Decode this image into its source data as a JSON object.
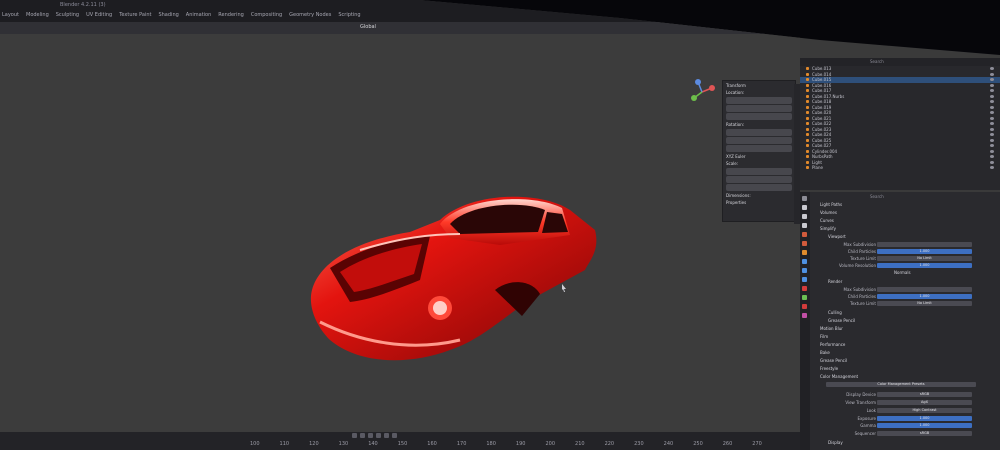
{
  "window": {
    "title": "Blender 4.2.11 (3)"
  },
  "menus": [
    "Layout",
    "Modeling",
    "Sculpting",
    "UV Editing",
    "Texture Paint",
    "Shading",
    "Animation",
    "Rendering",
    "Compositing",
    "Geometry Nodes",
    "Scripting"
  ],
  "viewport": {
    "mode": "Global"
  },
  "npanel": {
    "transform_header": "Transform",
    "location": "Location:",
    "rotation": "Rotation:",
    "mode": "XYZ Euler",
    "scale": "Scale:",
    "dimensions": "Dimensions:",
    "properties": "Properties"
  },
  "outliner": {
    "search_placeholder": "Search",
    "rows": [
      {
        "name": "Cube.013"
      },
      {
        "name": "Cube.014"
      },
      {
        "name": "Cube.015",
        "selected": true
      },
      {
        "name": "Cube.016"
      },
      {
        "name": "Cube.017"
      },
      {
        "name": "Cube.017.Nurbs"
      },
      {
        "name": "Cube.018"
      },
      {
        "name": "Cube.019"
      },
      {
        "name": "Cube.020"
      },
      {
        "name": "Cube.021"
      },
      {
        "name": "Cube.022"
      },
      {
        "name": "Cube.023"
      },
      {
        "name": "Cube.024"
      },
      {
        "name": "Cube.025"
      },
      {
        "name": "Cube.027"
      },
      {
        "name": "Cylinder.004"
      },
      {
        "name": "NurbsPath"
      },
      {
        "name": "Light"
      },
      {
        "name": "Plane"
      }
    ]
  },
  "properties": {
    "search_placeholder": "Search",
    "sections": {
      "light_paths": "Light Paths",
      "volumes": "Volumes",
      "curves": "Curves",
      "simplify": "Simplify",
      "viewport": "Viewport",
      "render": "Render",
      "culling": "Culling",
      "grease_pencil": "Grease Pencil",
      "motion_blur": "Motion Blur",
      "film": "Film",
      "performance": "Performance",
      "bake": "Bake",
      "freestyle": "Freestyle",
      "color_management": "Color Management"
    },
    "viewport_fields": {
      "max_subdivision_label": "Max Subdivision",
      "child_particles_label": "Child Particles",
      "child_particles_value": "1.000",
      "texture_limit_label": "Texture Limit",
      "texture_limit_value": "No Limit",
      "volume_resolution_label": "Volume Resolution",
      "volume_resolution_value": "1.000",
      "normals_label": "Normals"
    },
    "render_fields": {
      "max_subdivision_label": "Max Subdivision",
      "child_particles_label": "Child Particles",
      "child_particles_value": "1.000",
      "texture_limit_label": "Texture Limit",
      "texture_limit_value": "No Limit"
    },
    "color_fields": {
      "preset": "Color Management Presets",
      "display_device_label": "Display Device",
      "display_device_value": "sRGB",
      "view_transform_label": "View Transform",
      "view_transform_value": "AgX",
      "look_label": "Look",
      "look_value": "High Contrast",
      "exposure_label": "Exposure",
      "exposure_value": "1.000",
      "gamma_label": "Gamma",
      "gamma_value": "1.000",
      "sequencer_label": "Sequencer",
      "sequencer_value": "sRGB",
      "display_label": "Display"
    }
  },
  "timeline": {
    "frames": [
      "100",
      "110",
      "120",
      "130",
      "140",
      "150",
      "160",
      "170",
      "180",
      "190",
      "200",
      "210",
      "220",
      "230",
      "240",
      "250",
      "260",
      "270"
    ]
  },
  "colors": {
    "car_red": "#e3140f",
    "selection_blue": "#2e4f7a",
    "field_blue": "#3d6fc2",
    "viewport_gray": "#3c3c3c"
  }
}
